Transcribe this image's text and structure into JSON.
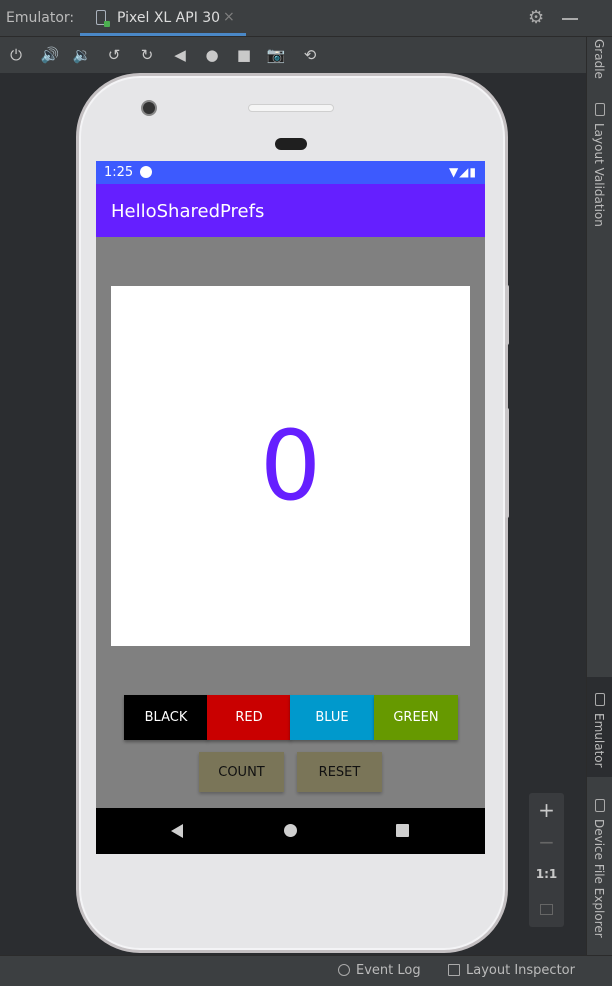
{
  "ide": {
    "panel_label": "Emulator:",
    "device_tab": "Pixel XL API 30",
    "close_glyph": "×",
    "right_tabs": {
      "gradle": "Gradle",
      "layout_validation": "Layout Validation",
      "emulator": "Emulator",
      "device_file_explorer": "Device File Explorer"
    },
    "status_bar": {
      "event_log": "Event Log",
      "layout_inspector": "Layout Inspector"
    },
    "zoom": {
      "plus": "+",
      "minus": "−",
      "one_to_one": "1:1"
    },
    "toolbar_icons": [
      "power-icon",
      "volume-up-icon",
      "volume-down-icon",
      "rotate-left-icon",
      "rotate-right-icon",
      "back-icon",
      "home-icon",
      "overview-icon",
      "screenshot-icon",
      "snapshot-icon"
    ]
  },
  "device": {
    "status": {
      "time": "1:25",
      "signal": "▼◢▮"
    },
    "app_title": "HelloSharedPrefs",
    "count": "0",
    "color_buttons": [
      {
        "label": "BLACK",
        "color": "#000000"
      },
      {
        "label": "RED",
        "color": "#c90000"
      },
      {
        "label": "BLUE",
        "color": "#0099cc"
      },
      {
        "label": "GREEN",
        "color": "#669900"
      }
    ],
    "action_buttons": {
      "count": "COUNT",
      "reset": "RESET"
    }
  },
  "colors": {
    "primary": "#651fff",
    "status_bar": "#3d5afe",
    "ide_accent": "#4a88c7"
  }
}
